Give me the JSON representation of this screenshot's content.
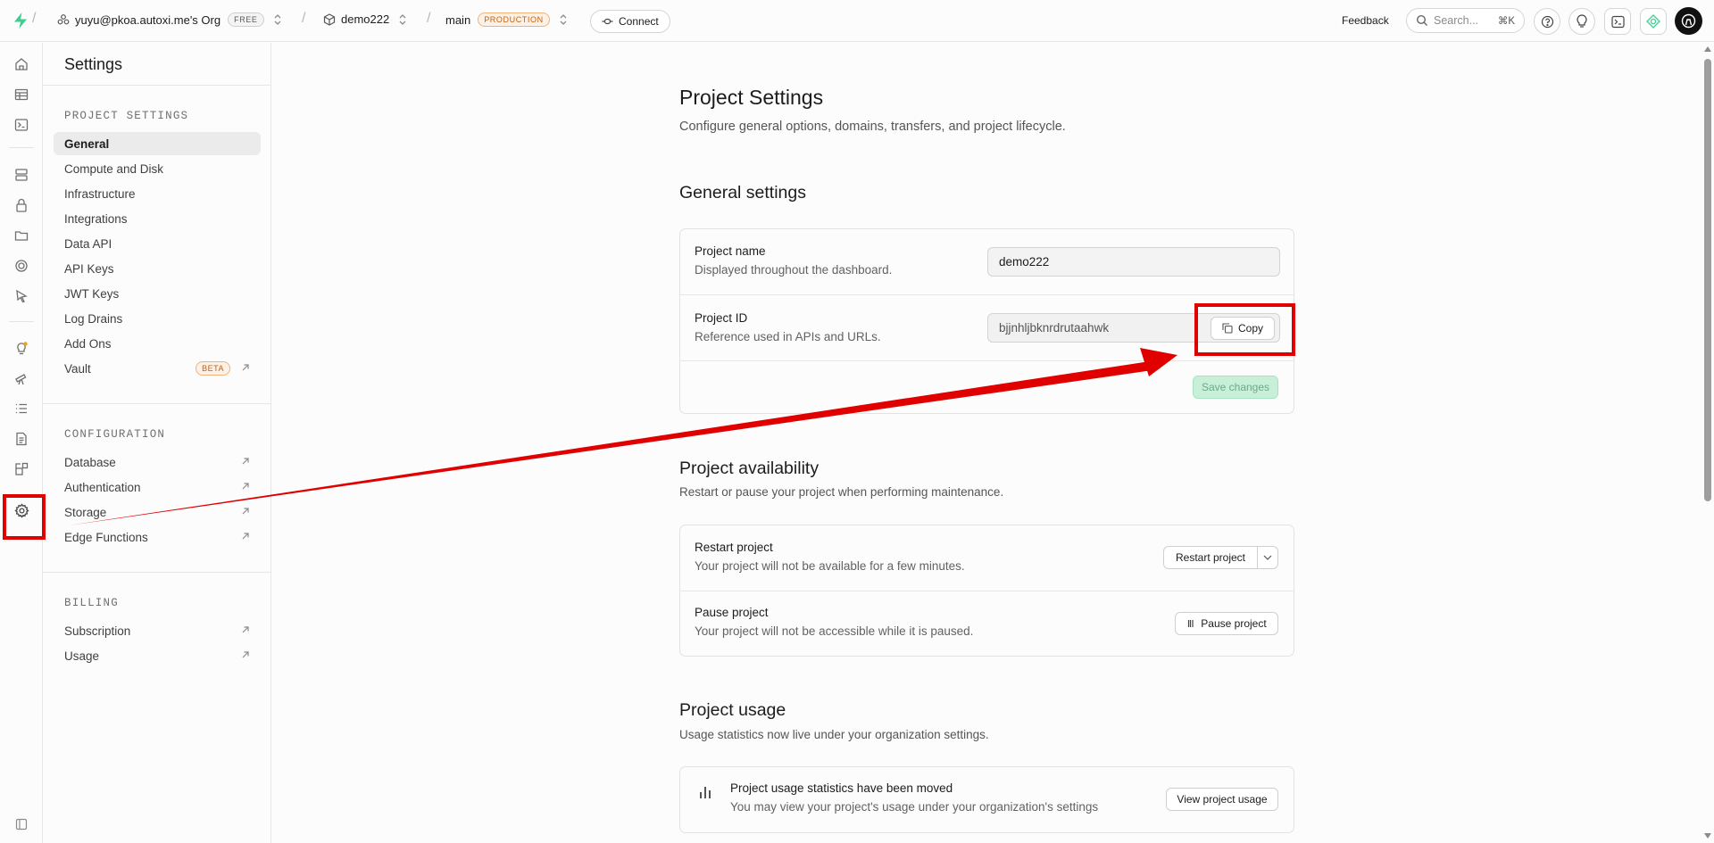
{
  "topbar": {
    "org": "yuyu@pkoa.autoxi.me's Org",
    "org_badge": "FREE",
    "project": "demo222",
    "branch": "main",
    "branch_badge": "PRODUCTION",
    "connect_label": "Connect",
    "feedback_label": "Feedback",
    "search_placeholder": "Search...",
    "search_shortcut": "⌘K"
  },
  "rail": {
    "icons": [
      "home-icon",
      "table-editor-icon",
      "sql-editor-icon",
      "database-icon",
      "auth-icon",
      "storage-icon",
      "realtime-icon",
      "edge-functions-icon",
      "advisors-icon",
      "observability-icon",
      "logs-icon",
      "api-docs-icon",
      "integrations-icon",
      "settings-icon",
      "collapse-icon"
    ]
  },
  "sidebar": {
    "title": "Settings",
    "project_settings_header": "PROJECT SETTINGS",
    "project_items": [
      "General",
      "Compute and Disk",
      "Infrastructure",
      "Integrations",
      "Data API",
      "API Keys",
      "JWT Keys",
      "Log Drains",
      "Add Ons",
      "Vault"
    ],
    "vault_badge": "BETA",
    "configuration_header": "CONFIGURATION",
    "configuration_items": [
      "Database",
      "Authentication",
      "Storage",
      "Edge Functions"
    ],
    "billing_header": "BILLING",
    "billing_items": [
      "Subscription",
      "Usage"
    ]
  },
  "main": {
    "title": "Project Settings",
    "subtitle": "Configure general options, domains, transfers, and project lifecycle.",
    "general": {
      "heading": "General settings",
      "name_label": "Project name",
      "name_desc": "Displayed throughout the dashboard.",
      "name_value": "demo222",
      "id_label": "Project ID",
      "id_desc": "Reference used in APIs and URLs.",
      "id_value": "bjjnhljbknrdrutaahwk",
      "copy_label": "Copy",
      "save_label": "Save changes"
    },
    "availability": {
      "heading": "Project availability",
      "subtitle": "Restart or pause your project when performing maintenance.",
      "restart_label": "Restart project",
      "restart_desc": "Your project will not be available for a few minutes.",
      "restart_button": "Restart project",
      "pause_label": "Pause project",
      "pause_desc": "Your project will not be accessible while it is paused.",
      "pause_button": "Pause project"
    },
    "usage": {
      "heading": "Project usage",
      "subtitle": "Usage statistics now live under your organization settings.",
      "notice_title": "Project usage statistics have been moved",
      "notice_desc": "You may view your project's usage under your organization's settings",
      "view_button": "View project usage"
    }
  },
  "colors": {
    "annotation": "#e00000",
    "brand": "#3ecf8e",
    "production": "#c2610c"
  }
}
